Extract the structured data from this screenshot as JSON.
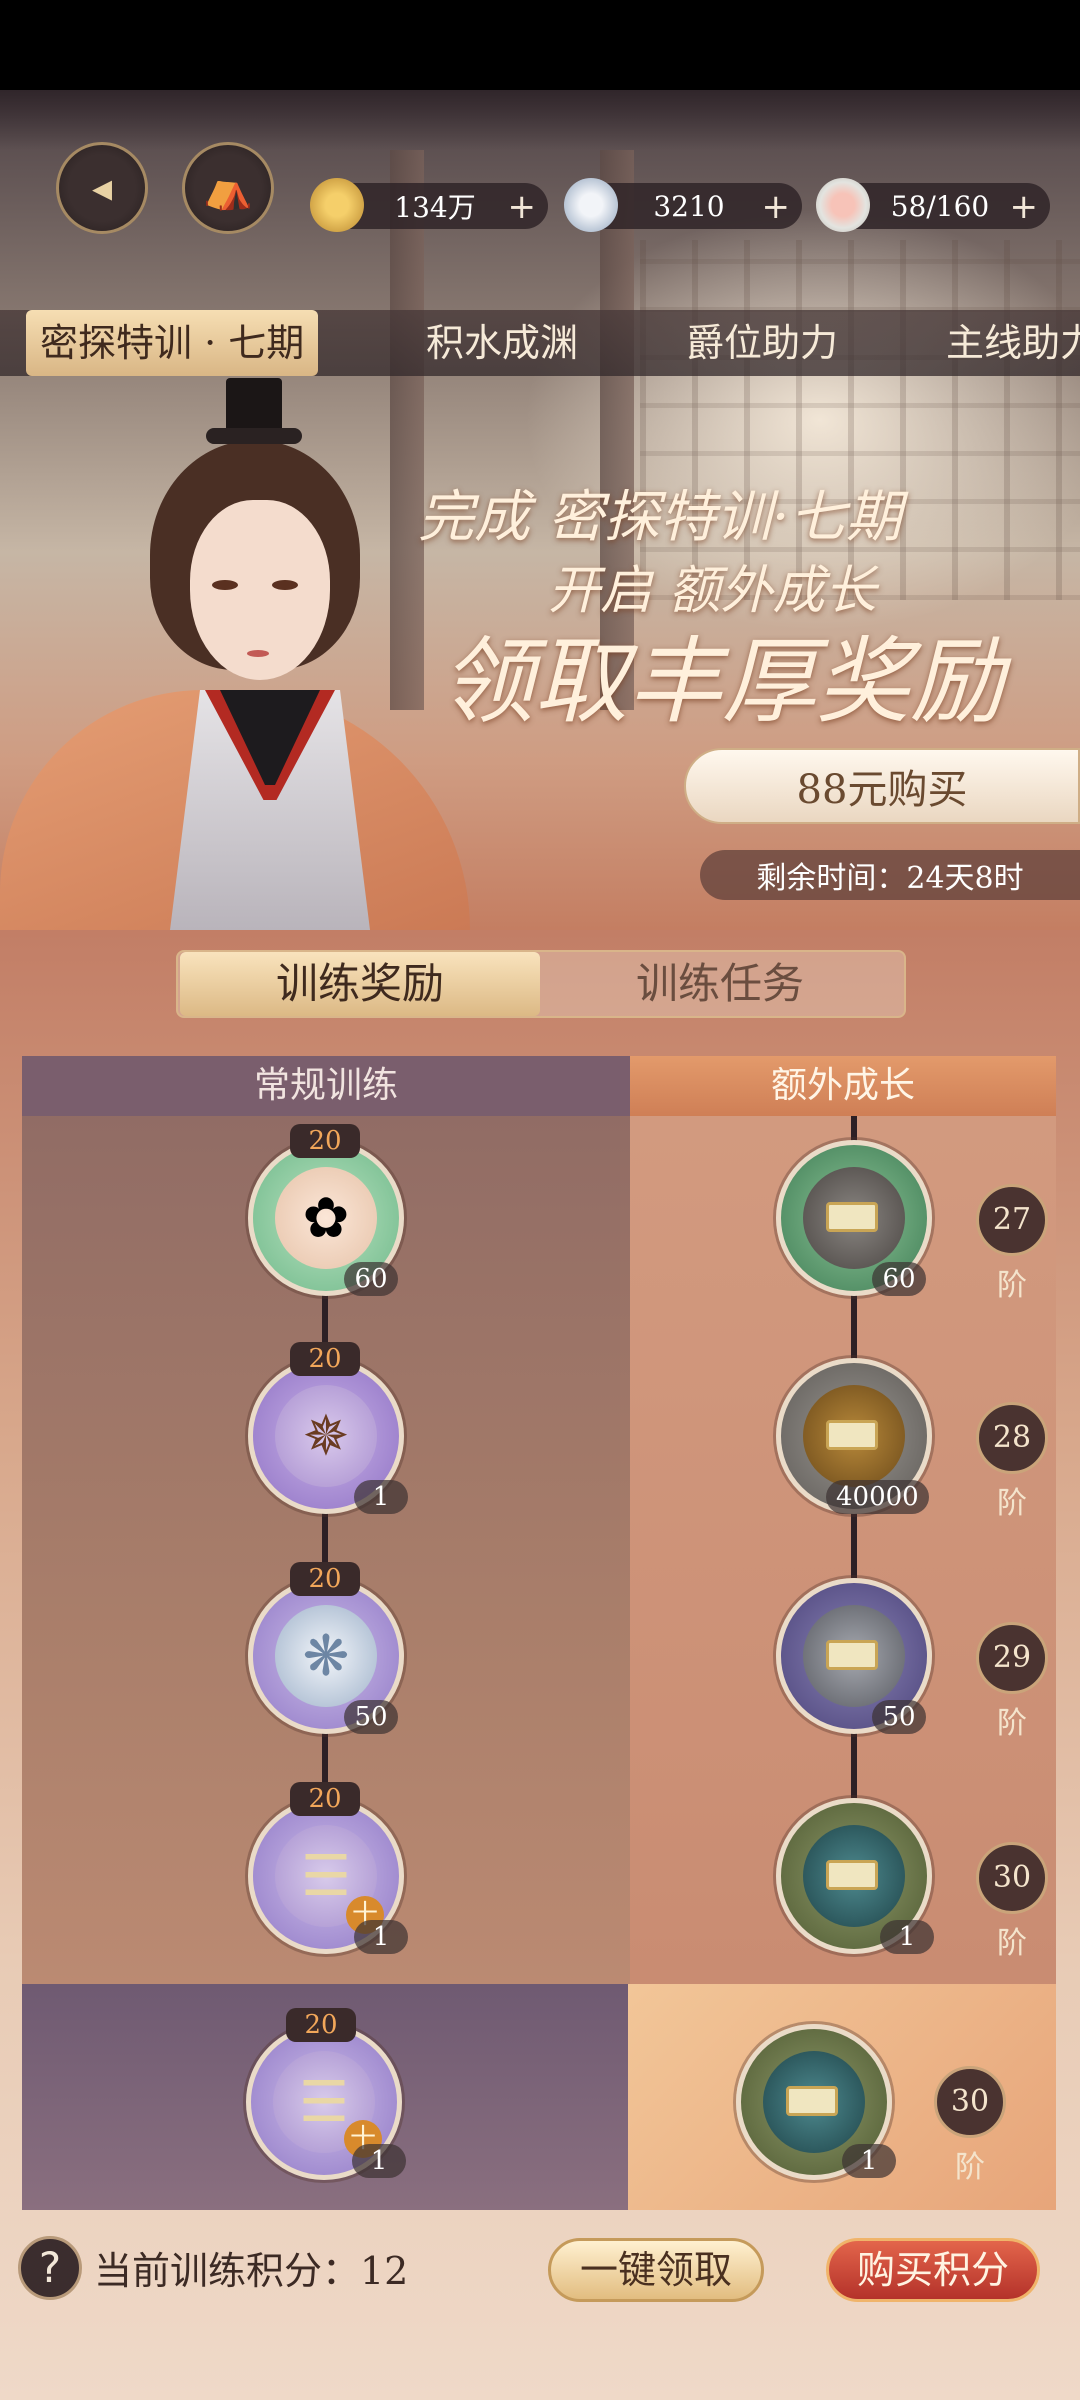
{
  "header": {
    "back_icon": "back-arrow-icon",
    "home_icon": "pavilion-icon",
    "currencies": [
      {
        "icon": "coin-icon",
        "value": "134万",
        "plus": "+"
      },
      {
        "icon": "silver-orb-icon",
        "value": "3210",
        "plus": "+"
      },
      {
        "icon": "food-bowl-icon",
        "value": "58/160",
        "plus": "+"
      }
    ]
  },
  "tabs": [
    "密探特训 · 七期",
    "积水成渊",
    "爵位助力",
    "主线助力"
  ],
  "banner": {
    "line1": "完成 密探特训·七期",
    "line2": "开启 额外成长",
    "line3": "领取丰厚奖励",
    "buy_label": "88元购买",
    "timer": "剩余时间：24天8时"
  },
  "segment": {
    "active": "训练奖励",
    "inactive": "训练任务"
  },
  "columns": {
    "left": "常规训练",
    "right": "额外成长"
  },
  "regular_rewards": [
    {
      "points": "20",
      "count": "60",
      "icon": "flower-bowl-icon"
    },
    {
      "points": "20",
      "count": "1",
      "icon": "rope-whip-icon"
    },
    {
      "points": "20",
      "count": "50",
      "icon": "silver-orb-icon"
    },
    {
      "points": "20",
      "count": "1",
      "icon": "bamboo-sticks-icon",
      "badge": "十"
    }
  ],
  "extra_rewards": [
    {
      "count": "60",
      "tier": "27阶",
      "icon": "locked-bowl-icon"
    },
    {
      "count": "40000",
      "tier": "28阶",
      "icon": "locked-coin-icon"
    },
    {
      "count": "50",
      "tier": "29阶",
      "icon": "locked-orb-icon"
    },
    {
      "count": "1",
      "tier": "30阶",
      "icon": "locked-scroll-icon"
    }
  ],
  "extra_row": {
    "left": {
      "points": "20",
      "count": "1",
      "badge": "十",
      "icon": "bamboo-sticks-icon"
    },
    "right": {
      "count": "1",
      "tier": "30阶",
      "icon": "locked-scroll-icon"
    }
  },
  "footer": {
    "help": "?",
    "score_label": "当前训练积分：12",
    "claim_all": "一键领取",
    "buy_points": "购买积分"
  }
}
